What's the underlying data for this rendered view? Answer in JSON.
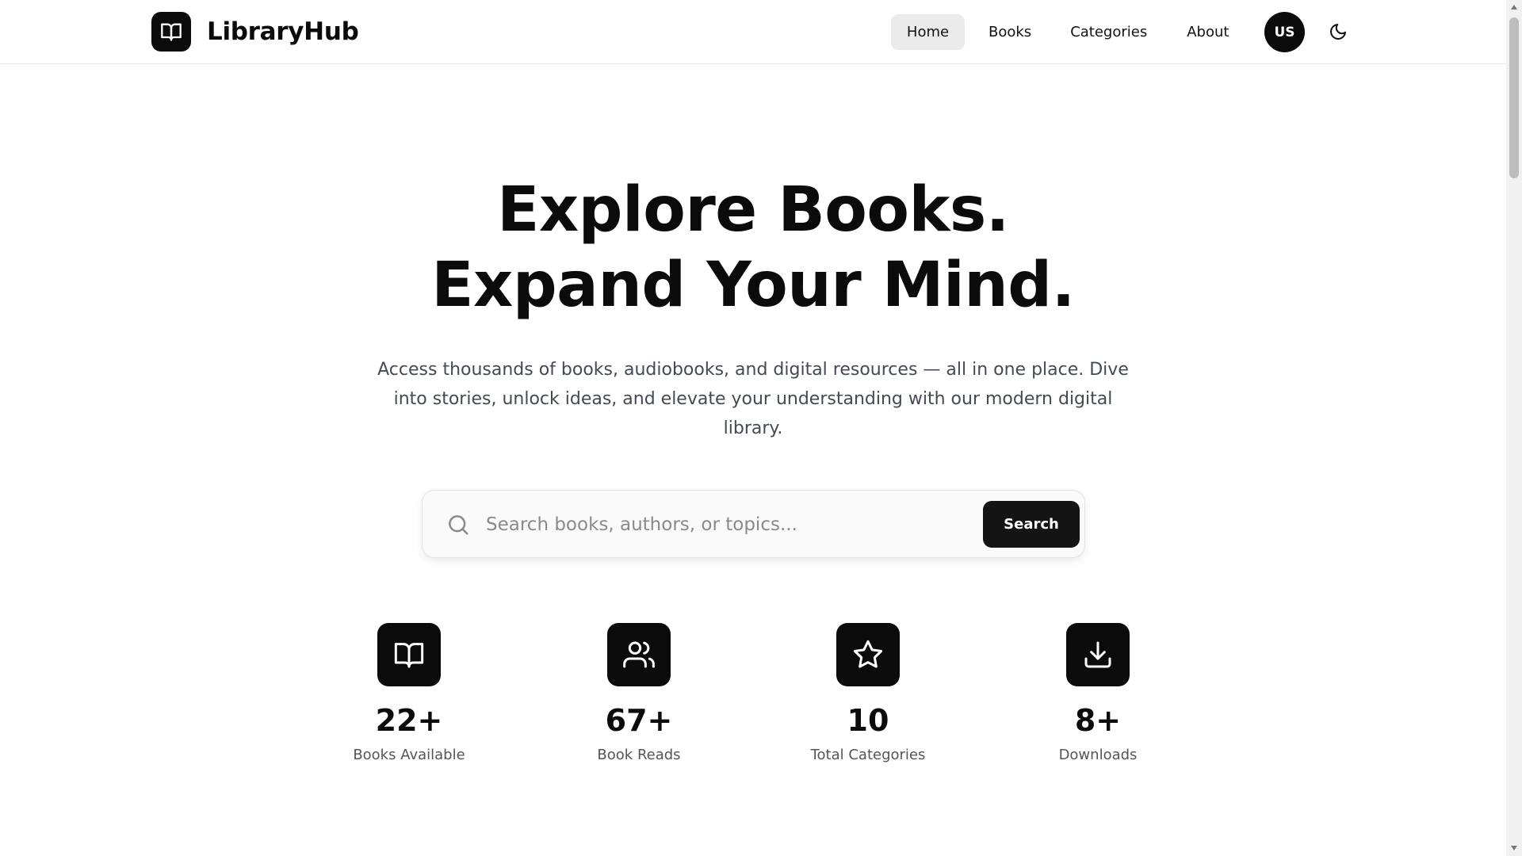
{
  "brand": {
    "name": "LibraryHub",
    "logo_icon": "open-book-icon"
  },
  "nav": {
    "items": [
      {
        "label": "Home",
        "active": true
      },
      {
        "label": "Books",
        "active": false
      },
      {
        "label": "Categories",
        "active": false
      },
      {
        "label": "About",
        "active": false
      }
    ],
    "avatar_initials": "US",
    "theme_toggle_icon": "moon-icon"
  },
  "hero": {
    "title_line1": "Explore Books.",
    "title_line2": "Expand Your Mind.",
    "subtitle": "Access thousands of books, audiobooks, and digital resources — all in one place. Dive into stories, unlock ideas, and elevate your understanding with our modern digital library."
  },
  "search": {
    "placeholder": "Search books, authors, or topics...",
    "value": "",
    "button_label": "Search",
    "icon": "search-icon"
  },
  "stats": [
    {
      "value": "22+",
      "label": "Books Available",
      "icon": "open-book-icon"
    },
    {
      "value": "67+",
      "label": "Book Reads",
      "icon": "users-icon"
    },
    {
      "value": "10",
      "label": "Total Categories",
      "icon": "star-icon"
    },
    {
      "value": "8+",
      "label": "Downloads",
      "icon": "download-icon"
    }
  ],
  "colors": {
    "primary": "#0b0b0b",
    "nav_active_bg": "#ebebeb",
    "subtitle_text": "#444a55",
    "background": "#ffffff"
  }
}
